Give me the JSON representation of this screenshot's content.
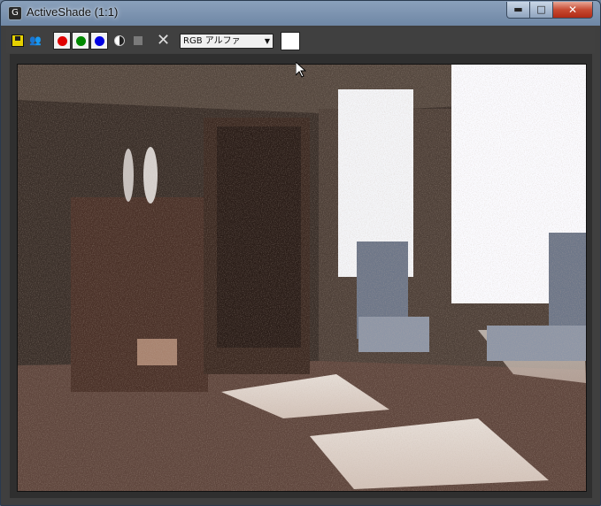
{
  "window": {
    "title": "ActiveShade (1:1)"
  },
  "titlebar": {
    "min_glyph": "▬",
    "max_glyph": "□",
    "close_glyph": "✕"
  },
  "toolbar": {
    "channel_display": "RGB アルファ",
    "channels": [
      "red",
      "green",
      "blue"
    ],
    "swatch_color": "#ffffff"
  },
  "render": {
    "description_colors": {
      "wall": "#5a4a3e",
      "window_light": "#fbfbff",
      "floor": "#6b4f45"
    }
  }
}
